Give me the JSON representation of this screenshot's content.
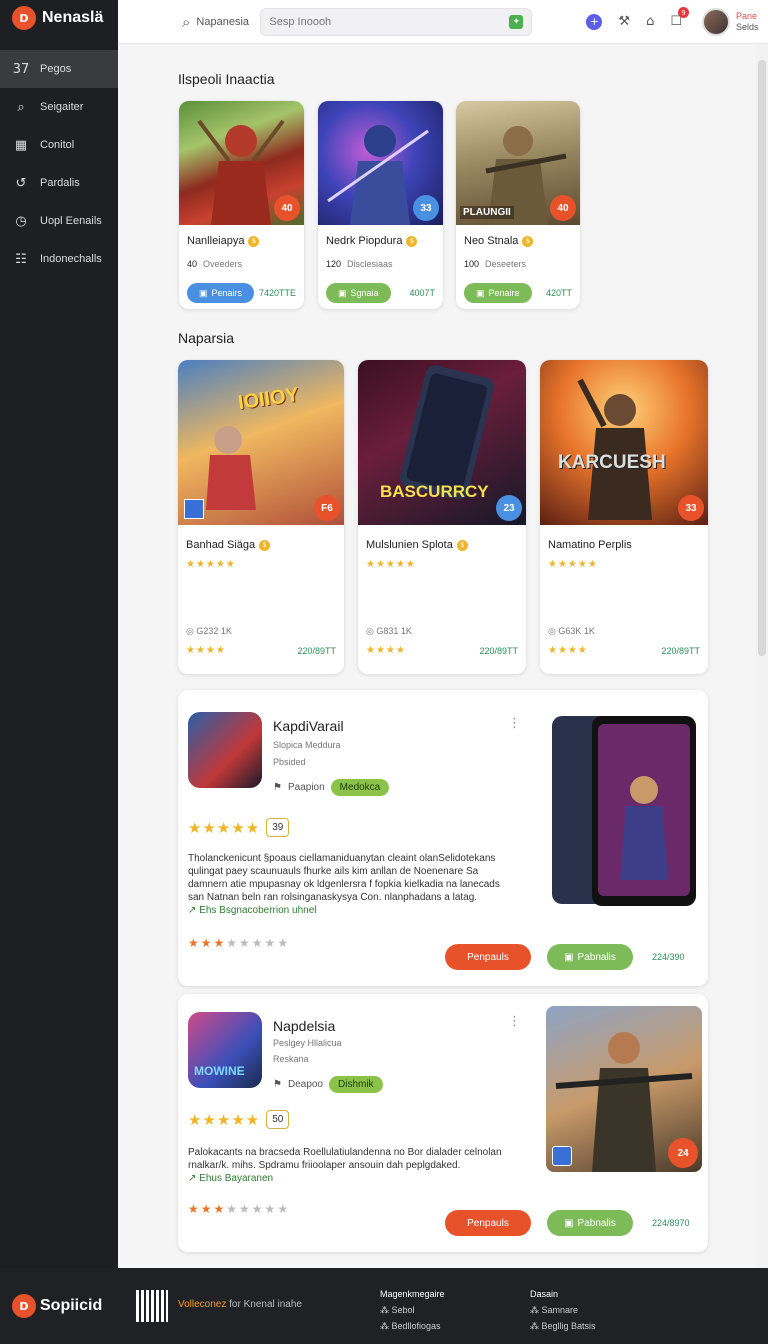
{
  "sidebar": {
    "brand": "Nenaslä",
    "items": [
      {
        "icon": "37",
        "label": "Pegos"
      },
      {
        "icon": "⌕",
        "label": "Seigaiter"
      },
      {
        "icon": "▦",
        "label": "Conitol"
      },
      {
        "icon": "↺",
        "label": "Pardalis"
      },
      {
        "icon": "◷",
        "label": "Uopl Eenails"
      },
      {
        "icon": "☷",
        "label": "Indonechalls"
      }
    ]
  },
  "topbar": {
    "crumb": "Napanesia",
    "search_placeholder": "Sesp Inoooh",
    "user_name": "Pane",
    "user_sub": "Selds",
    "notif_count": "9"
  },
  "section1": {
    "title": "Ilspeoli Inaactia",
    "cards": [
      {
        "title": "Nanlleiapya",
        "rank": "40",
        "meta": "Oveeders",
        "button": "Penairs",
        "price": "7420TTE",
        "score": "40",
        "accent": "#4a90e2"
      },
      {
        "title": "Nedrk Piopdura",
        "rank": "120",
        "meta": "Disclesiaas",
        "button": "Sgnaia",
        "price": "4007T",
        "score": "33",
        "accent": "#7cbb57"
      },
      {
        "title": "Neo Stnala",
        "rank": "100",
        "meta": "Deseeters",
        "button": "Penaire",
        "price": "420TT",
        "score": "40",
        "accent": "#7cbb57",
        "banner": "PLAUNGII"
      }
    ]
  },
  "section2": {
    "title": "Naparsia",
    "cards": [
      {
        "title": "Banhad Siäga",
        "art": "IOIIOY",
        "count": "G232 1K",
        "price": "220/89TT",
        "score": "F6"
      },
      {
        "title": "Mulslunien Splota",
        "art": "BASCURRCY",
        "count": "G831 1K",
        "price": "220/89TT",
        "score": "23"
      },
      {
        "title": "Namatino Perplis",
        "art": "KARCUESH",
        "count": "G63K 1K",
        "price": "220/89TT",
        "score": "33"
      }
    ]
  },
  "listing1": {
    "name": "KapdiVarail",
    "sub1": "Slopica Meddura",
    "sub2": "Pbsided",
    "chip_label": "Paapion",
    "chip": "Medokca",
    "rating": "39",
    "desc": "Tholanckenicunt §poaus ciellamaniduanytan cleaint olanSelidotekans qulingat paey scaunuauls fhurke ails kim anllan de Noenenare Sa damnern atie mpupasnay ok ldgenlersra f fopkia kielkadia na lanecads san Natnan beln ran rolsinganaskysya Con. nlanphadans a latag.",
    "link": "Ehs Bsgnacoberrion uhnel",
    "btn1": "Penpauls",
    "btn2": "Pabnalis",
    "price": "224/390"
  },
  "listing2": {
    "name": "Napdelsia",
    "sub1": "Peslgey Hllalicua",
    "sub2": "Reskana",
    "chip_label": "Deapoo",
    "chip": "Dishmik",
    "rating": "50",
    "desc": "Palokacants na bracseda Roellulatiulandenna no Bor dialader celnolan rnalkar/k. mihs. Spdramu friioolaper ansouin dah peplgdaked.",
    "link": "Ehus Bayaranen",
    "btn1": "Penpauls",
    "btn2": "Pabnalis",
    "price": "224/8970",
    "score": "24",
    "art": "MOWINE"
  },
  "footer": {
    "brand": "Sopiicid",
    "tag_hl": "Volleconez",
    "tag": "for Knenal inahe",
    "col1": [
      "Magenkmegaire",
      "Sebol",
      "Bedllofiogas"
    ],
    "col2": [
      "Dasain",
      "Samnare",
      "Begllig Batsis"
    ]
  },
  "colors": {
    "accent": "#e8522a",
    "green": "#7cbb57",
    "blue": "#4a90e2"
  }
}
